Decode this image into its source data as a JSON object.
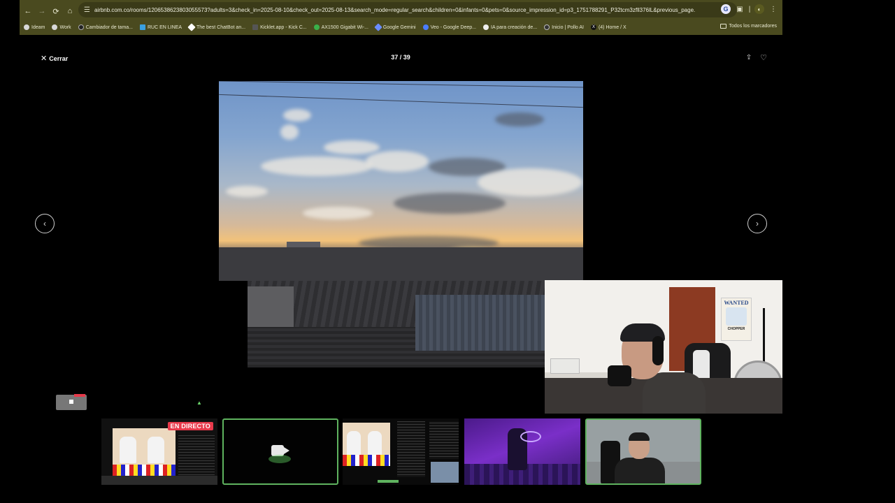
{
  "browser": {
    "url": "airbnb.com.co/rooms/1206538623803055573?adults=3&check_in=2025-08-10&check_out=2025-08-13&search_mode=regular_search&children=0&infants=0&pets=0&source_impression_id=p3_1751788291_P32tcm3zfll376lL&previous_page...",
    "bookmarks": [
      {
        "label": "Ideam",
        "color": "#d8d8d8"
      },
      {
        "label": "Work",
        "color": "#d8d8d8"
      },
      {
        "label": "Cambiador de tama...",
        "color": "#222222"
      },
      {
        "label": "RUC EN LINEA",
        "color": "#3aa0e0"
      },
      {
        "label": "The best ChatBot an...",
        "color": "#ffffff"
      },
      {
        "label": "Kicklet.app - Kick C...",
        "color": "#555555"
      },
      {
        "label": "AX1500 Gigabit Wi-...",
        "color": "#3ab04a"
      },
      {
        "label": "Google Gemini",
        "color": "#6a8cff"
      },
      {
        "label": "Veo - Google Deep...",
        "color": "#4a7cff"
      },
      {
        "label": "IA para creación de...",
        "color": "#eeeeee"
      },
      {
        "label": "Inicio | Pollo AI",
        "color": "#333333"
      },
      {
        "label": "(4) Home / X",
        "color": "#111111"
      }
    ],
    "all_bookmarks": "Todos los marcadores"
  },
  "viewer": {
    "close_label": "Cerrar",
    "counter": "37 / 39"
  },
  "webcam": {
    "poster_title": "WANTED",
    "poster_name": "CHOPPER"
  },
  "scenes": {
    "live_badge": "EN DIRECTO"
  }
}
